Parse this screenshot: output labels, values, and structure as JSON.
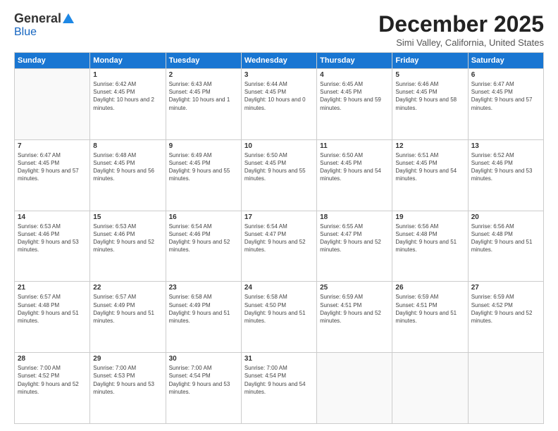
{
  "logo": {
    "general": "General",
    "blue": "Blue"
  },
  "header": {
    "title": "December 2025",
    "subtitle": "Simi Valley, California, United States"
  },
  "weekdays": [
    "Sunday",
    "Monday",
    "Tuesday",
    "Wednesday",
    "Thursday",
    "Friday",
    "Saturday"
  ],
  "weeks": [
    [
      {
        "day": "",
        "sunrise": "",
        "sunset": "",
        "daylight": ""
      },
      {
        "day": "1",
        "sunrise": "Sunrise: 6:42 AM",
        "sunset": "Sunset: 4:45 PM",
        "daylight": "Daylight: 10 hours and 2 minutes."
      },
      {
        "day": "2",
        "sunrise": "Sunrise: 6:43 AM",
        "sunset": "Sunset: 4:45 PM",
        "daylight": "Daylight: 10 hours and 1 minute."
      },
      {
        "day": "3",
        "sunrise": "Sunrise: 6:44 AM",
        "sunset": "Sunset: 4:45 PM",
        "daylight": "Daylight: 10 hours and 0 minutes."
      },
      {
        "day": "4",
        "sunrise": "Sunrise: 6:45 AM",
        "sunset": "Sunset: 4:45 PM",
        "daylight": "Daylight: 9 hours and 59 minutes."
      },
      {
        "day": "5",
        "sunrise": "Sunrise: 6:46 AM",
        "sunset": "Sunset: 4:45 PM",
        "daylight": "Daylight: 9 hours and 58 minutes."
      },
      {
        "day": "6",
        "sunrise": "Sunrise: 6:47 AM",
        "sunset": "Sunset: 4:45 PM",
        "daylight": "Daylight: 9 hours and 57 minutes."
      }
    ],
    [
      {
        "day": "7",
        "sunrise": "Sunrise: 6:47 AM",
        "sunset": "Sunset: 4:45 PM",
        "daylight": "Daylight: 9 hours and 57 minutes."
      },
      {
        "day": "8",
        "sunrise": "Sunrise: 6:48 AM",
        "sunset": "Sunset: 4:45 PM",
        "daylight": "Daylight: 9 hours and 56 minutes."
      },
      {
        "day": "9",
        "sunrise": "Sunrise: 6:49 AM",
        "sunset": "Sunset: 4:45 PM",
        "daylight": "Daylight: 9 hours and 55 minutes."
      },
      {
        "day": "10",
        "sunrise": "Sunrise: 6:50 AM",
        "sunset": "Sunset: 4:45 PM",
        "daylight": "Daylight: 9 hours and 55 minutes."
      },
      {
        "day": "11",
        "sunrise": "Sunrise: 6:50 AM",
        "sunset": "Sunset: 4:45 PM",
        "daylight": "Daylight: 9 hours and 54 minutes."
      },
      {
        "day": "12",
        "sunrise": "Sunrise: 6:51 AM",
        "sunset": "Sunset: 4:45 PM",
        "daylight": "Daylight: 9 hours and 54 minutes."
      },
      {
        "day": "13",
        "sunrise": "Sunrise: 6:52 AM",
        "sunset": "Sunset: 4:46 PM",
        "daylight": "Daylight: 9 hours and 53 minutes."
      }
    ],
    [
      {
        "day": "14",
        "sunrise": "Sunrise: 6:53 AM",
        "sunset": "Sunset: 4:46 PM",
        "daylight": "Daylight: 9 hours and 53 minutes."
      },
      {
        "day": "15",
        "sunrise": "Sunrise: 6:53 AM",
        "sunset": "Sunset: 4:46 PM",
        "daylight": "Daylight: 9 hours and 52 minutes."
      },
      {
        "day": "16",
        "sunrise": "Sunrise: 6:54 AM",
        "sunset": "Sunset: 4:46 PM",
        "daylight": "Daylight: 9 hours and 52 minutes."
      },
      {
        "day": "17",
        "sunrise": "Sunrise: 6:54 AM",
        "sunset": "Sunset: 4:47 PM",
        "daylight": "Daylight: 9 hours and 52 minutes."
      },
      {
        "day": "18",
        "sunrise": "Sunrise: 6:55 AM",
        "sunset": "Sunset: 4:47 PM",
        "daylight": "Daylight: 9 hours and 52 minutes."
      },
      {
        "day": "19",
        "sunrise": "Sunrise: 6:56 AM",
        "sunset": "Sunset: 4:48 PM",
        "daylight": "Daylight: 9 hours and 51 minutes."
      },
      {
        "day": "20",
        "sunrise": "Sunrise: 6:56 AM",
        "sunset": "Sunset: 4:48 PM",
        "daylight": "Daylight: 9 hours and 51 minutes."
      }
    ],
    [
      {
        "day": "21",
        "sunrise": "Sunrise: 6:57 AM",
        "sunset": "Sunset: 4:48 PM",
        "daylight": "Daylight: 9 hours and 51 minutes."
      },
      {
        "day": "22",
        "sunrise": "Sunrise: 6:57 AM",
        "sunset": "Sunset: 4:49 PM",
        "daylight": "Daylight: 9 hours and 51 minutes."
      },
      {
        "day": "23",
        "sunrise": "Sunrise: 6:58 AM",
        "sunset": "Sunset: 4:49 PM",
        "daylight": "Daylight: 9 hours and 51 minutes."
      },
      {
        "day": "24",
        "sunrise": "Sunrise: 6:58 AM",
        "sunset": "Sunset: 4:50 PM",
        "daylight": "Daylight: 9 hours and 51 minutes."
      },
      {
        "day": "25",
        "sunrise": "Sunrise: 6:59 AM",
        "sunset": "Sunset: 4:51 PM",
        "daylight": "Daylight: 9 hours and 52 minutes."
      },
      {
        "day": "26",
        "sunrise": "Sunrise: 6:59 AM",
        "sunset": "Sunset: 4:51 PM",
        "daylight": "Daylight: 9 hours and 51 minutes."
      },
      {
        "day": "27",
        "sunrise": "Sunrise: 6:59 AM",
        "sunset": "Sunset: 4:52 PM",
        "daylight": "Daylight: 9 hours and 52 minutes."
      }
    ],
    [
      {
        "day": "28",
        "sunrise": "Sunrise: 7:00 AM",
        "sunset": "Sunset: 4:52 PM",
        "daylight": "Daylight: 9 hours and 52 minutes."
      },
      {
        "day": "29",
        "sunrise": "Sunrise: 7:00 AM",
        "sunset": "Sunset: 4:53 PM",
        "daylight": "Daylight: 9 hours and 53 minutes."
      },
      {
        "day": "30",
        "sunrise": "Sunrise: 7:00 AM",
        "sunset": "Sunset: 4:54 PM",
        "daylight": "Daylight: 9 hours and 53 minutes."
      },
      {
        "day": "31",
        "sunrise": "Sunrise: 7:00 AM",
        "sunset": "Sunset: 4:54 PM",
        "daylight": "Daylight: 9 hours and 54 minutes."
      },
      {
        "day": "",
        "sunrise": "",
        "sunset": "",
        "daylight": ""
      },
      {
        "day": "",
        "sunrise": "",
        "sunset": "",
        "daylight": ""
      },
      {
        "day": "",
        "sunrise": "",
        "sunset": "",
        "daylight": ""
      }
    ]
  ]
}
